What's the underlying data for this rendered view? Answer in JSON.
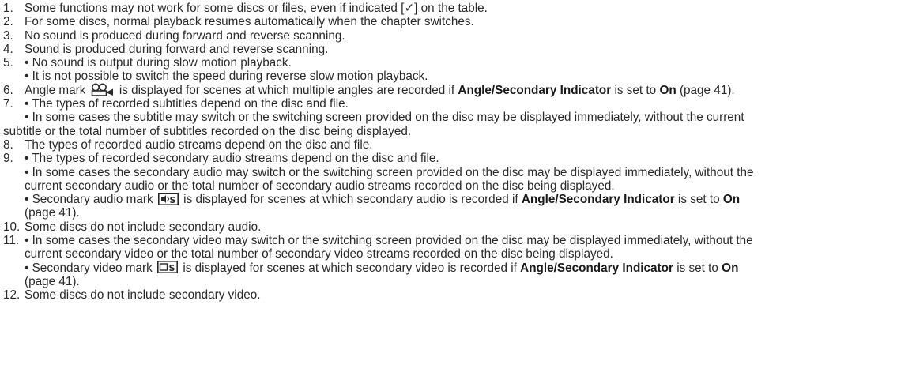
{
  "notes": [
    {
      "num": "1.",
      "text": "Some functions may not work for some discs or files, even if indicated [✓] on the table."
    },
    {
      "num": "2.",
      "text": "For some discs, normal playback resumes automatically when the chapter switches."
    },
    {
      "num": "3.",
      "text": "No sound is produced during forward and reverse scanning."
    },
    {
      "num": "4.",
      "text": "Sound is produced during forward and reverse scanning."
    },
    {
      "num": "5.",
      "b1": "• No sound is output during slow motion playback.",
      "b2": "• It is not possible to switch the speed during reverse slow motion playback."
    },
    {
      "num": "6.",
      "a": "Angle mark",
      "b": "is displayed for scenes at which multiple angles are recorded if",
      "bold1": "Angle/Secondary Indicator",
      "c": "is set to",
      "bold2": "On",
      "d": "(page 41)."
    },
    {
      "num": "7.",
      "b1": "• The types of recorded subtitles depend on the disc and file.",
      "b2a": "• In some cases the subtitle may switch or the switching screen provided on the disc may be displayed immediately, without the current",
      "b2b": "subtitle or the total number of subtitles recorded on the disc being displayed."
    },
    {
      "num": "8.",
      "text": "The types of recorded audio streams depend on the disc and file."
    },
    {
      "num": "9.",
      "b1": "• The types of recorded secondary audio streams depend on the disc and file.",
      "b2a": "• In some cases the secondary audio may switch or the switching screen provided on the disc may be displayed immediately, without the",
      "b2b": "current secondary audio or the total number of secondary audio streams recorded on the disc being displayed.",
      "b3a": "• Secondary audio mark",
      "b3b": "is displayed for scenes at which secondary audio is recorded if",
      "bold1": "Angle/Secondary Indicator",
      "b3c": "is set to",
      "bold2": "On",
      "b3d": "(page 41)."
    },
    {
      "num": "10.",
      "text": "Some discs do not include secondary audio."
    },
    {
      "num": "11.",
      "b1a": "• In some cases the secondary video may switch or the switching screen provided on the disc may be displayed immediately, without the",
      "b1b": "current secondary video or the total number of secondary video streams recorded on the disc being displayed.",
      "b2a": "• Secondary video mark",
      "b2b": "is displayed for scenes at which secondary video is recorded if",
      "bold1": "Angle/Secondary Indicator",
      "b2c": "is set to",
      "bold2": "On",
      "b2d": "(page 41)."
    },
    {
      "num": "12.",
      "text": "Some discs do not include secondary video."
    }
  ],
  "icons": {
    "angle": "angle-mark-icon",
    "secondary_audio": "secondary-audio-mark-icon",
    "secondary_video": "secondary-video-mark-icon"
  }
}
